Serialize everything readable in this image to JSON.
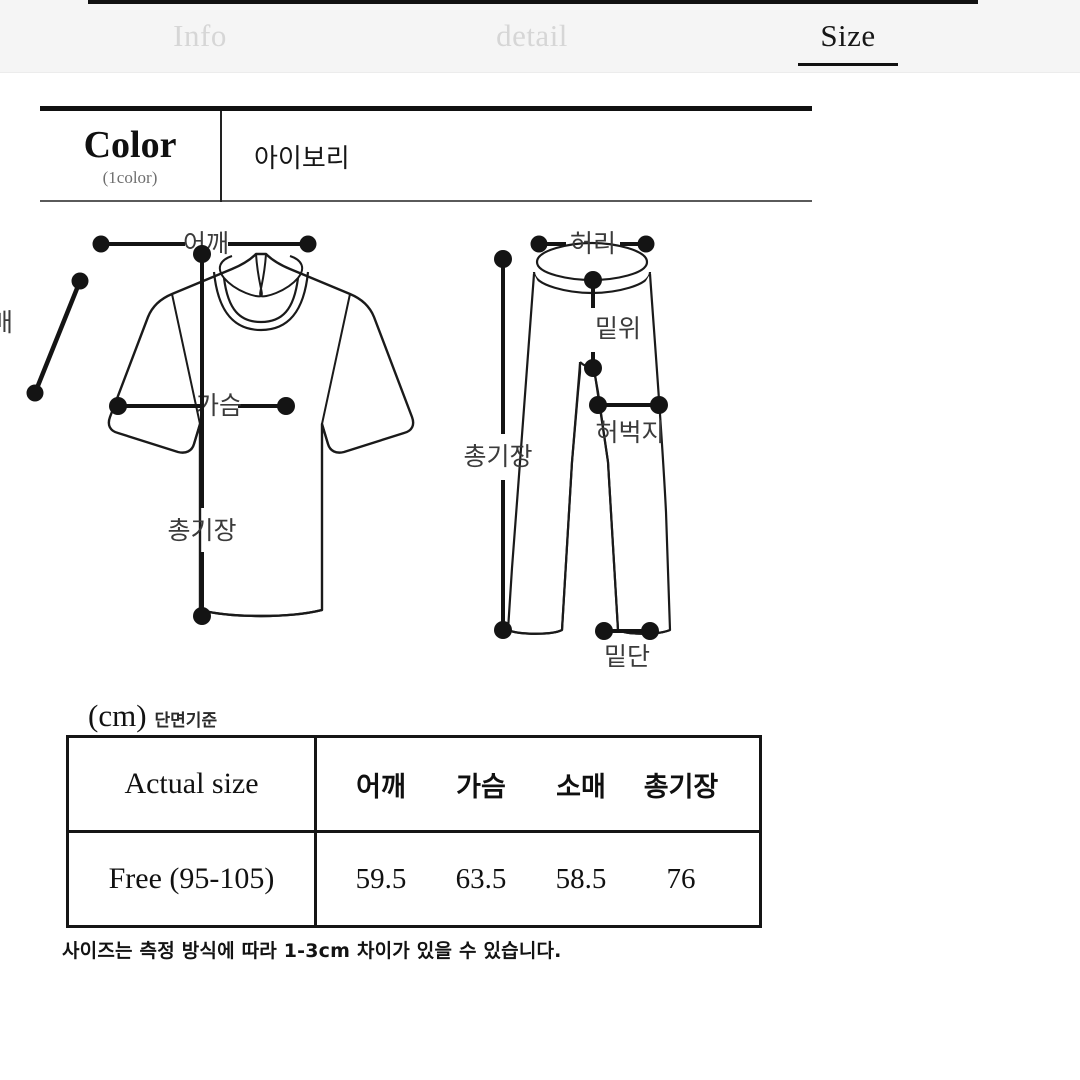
{
  "tabs": [
    {
      "label": "Info",
      "active": false
    },
    {
      "label": "detail",
      "active": false
    },
    {
      "label": "Size",
      "active": true
    }
  ],
  "color_section": {
    "title": "Color",
    "subtitle": "(1color)",
    "value": "아이보리"
  },
  "diagrams": {
    "top_garment": {
      "name": "t-shirt",
      "labels": {
        "shoulder": "어깨",
        "sleeve": "소매",
        "chest": "가슴",
        "total_length": "총기장"
      }
    },
    "bottom_garment": {
      "name": "pants",
      "labels": {
        "waist": "허리",
        "rise": "밑위",
        "thigh": "허벅지",
        "hem": "밑단",
        "total_length": "총기장"
      }
    }
  },
  "size_table": {
    "unit": "(cm)",
    "measure_note": "단면기준",
    "row_header_label": "Actual size",
    "columns": [
      "어깨",
      "가슴",
      "소매",
      "총기장"
    ],
    "rows": [
      {
        "size": "Free (95-105)",
        "values": [
          "59.5",
          "63.5",
          "58.5",
          "76"
        ]
      }
    ],
    "footnote": "사이즈는 측정 방식에 따라 1-3cm 차이가 있을 수 있습니다."
  },
  "colors": {
    "ink": "#111111",
    "muted_tab": "#d6d6d6",
    "header_bg": "#f5f5f5",
    "label_gray": "#3b3b3b"
  }
}
